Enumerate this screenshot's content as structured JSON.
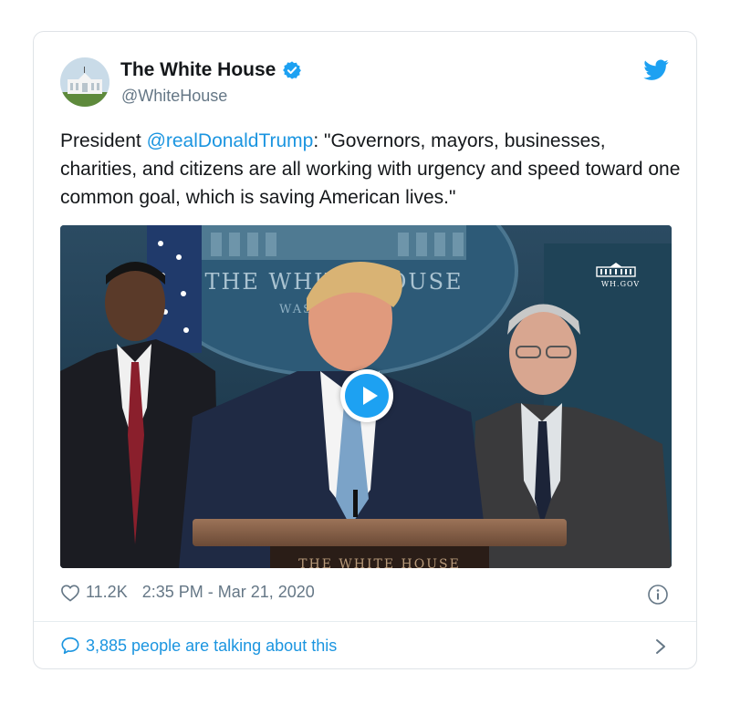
{
  "tweet": {
    "display_name": "The White House",
    "handle": "@WhiteHouse",
    "text_prefix": "President ",
    "mention": "@realDonaldTrump",
    "text_body": ": \"Governors, mayors, businesses, charities, and citizens are all working with urgency and speed toward one common goal, which is saving American lives.\"",
    "likes": "11.2K",
    "timestamp": "2:35 PM - Mar 21, 2020",
    "talking": "3,885 people are talking about this"
  },
  "media": {
    "seal_text": "THE WHITE HOUSE",
    "seal_sub": "WASHINGTON",
    "badge_text": "WH.GOV",
    "podium_text": "THE WHITE HOUSE"
  },
  "icons": {
    "verified": "verified-badge-icon",
    "brand": "twitter-bird-icon",
    "like": "heart-icon",
    "info": "info-icon",
    "reply": "speech-bubble-icon",
    "more": "chevron-right-icon",
    "play": "play-icon"
  },
  "colors": {
    "accent": "#1da1f2",
    "link": "#1b95e0",
    "muted": "#657786",
    "text": "#14171a"
  }
}
